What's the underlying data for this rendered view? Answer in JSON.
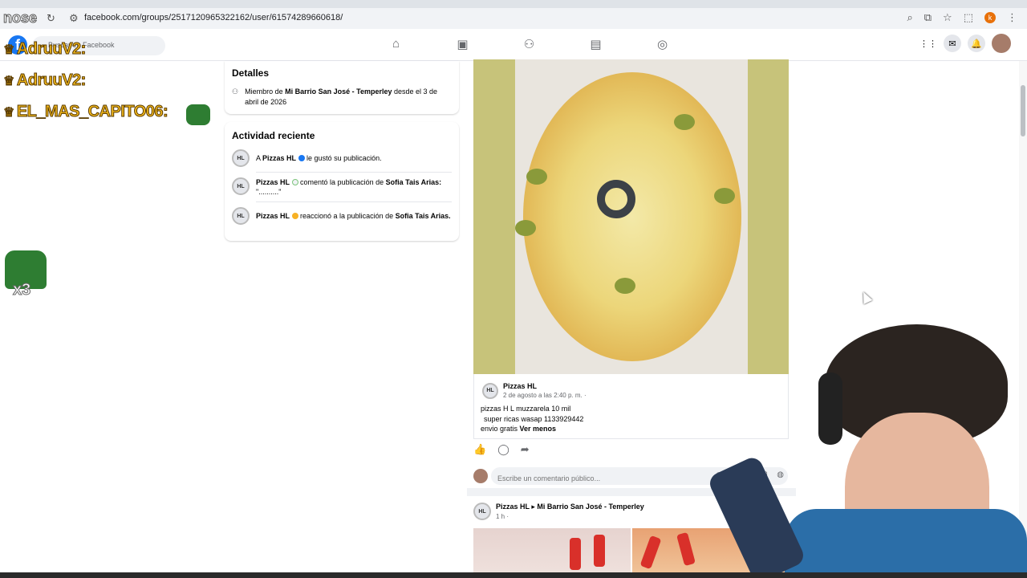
{
  "browser": {
    "url": "facebook.com/groups/2517120965322162/user/61574289660618/",
    "profile_initial": "k"
  },
  "fb": {
    "search_placeholder": "Buscar en Facebook",
    "logo": "f"
  },
  "stream_overlay": {
    "top_word": "nose",
    "chat": [
      {
        "user": "AdruuV2:"
      },
      {
        "user": "AdruuV2:"
      },
      {
        "user": "EL_MAS_CAPITO06:"
      }
    ],
    "multiplier": "x3"
  },
  "details": {
    "title": "Detalles",
    "member_prefix": "Miembro de ",
    "group_name": "Mi Barrio San José - Temperley",
    "member_suffix": " desde el 3 de abril de 2026"
  },
  "recent_activity": {
    "title": "Actividad reciente",
    "items": [
      {
        "prefix": "A ",
        "actor": "Pizzas HL",
        "text": " le gustó su publicación.",
        "target": ""
      },
      {
        "prefix": "",
        "actor": "Pizzas HL",
        "text": " comentó la publicación de ",
        "target": "Sofia Tais Arias:",
        "extra": "\"..........\""
      },
      {
        "prefix": "",
        "actor": "Pizzas HL",
        "text": " reaccionó a la publicación de ",
        "target": "Sofia Tais Arias."
      }
    ],
    "avatar_text": "HL"
  },
  "post": {
    "author": "Pizzas HL",
    "time": "2 de agosto a las 2:40 p. m. ·",
    "line1": "pizzas H L muzzarela 10 mil",
    "line2": "super ricas wasap 1133929442",
    "line3_prefix": "envio gratis ",
    "see_less": "Ver menos",
    "comment_placeholder": "Escribe un comentario público..."
  },
  "post2": {
    "author": "Pizzas HL",
    "arrow": "▸",
    "group": "Mi Barrio San José - Temperley",
    "time": "1 h ·"
  },
  "colors": {
    "fb_blue": "#1877f2",
    "chat_gold": "#f0b71c",
    "photo_bg": "#c7c37a"
  }
}
